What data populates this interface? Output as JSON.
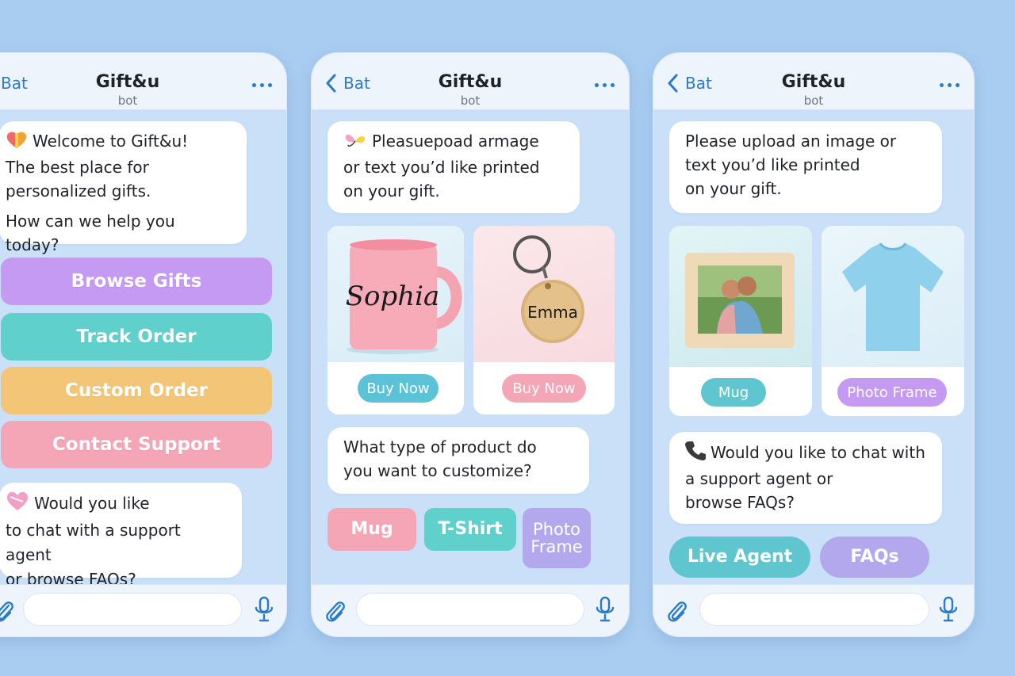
{
  "colors": {
    "background": "#a9cdf1",
    "accent": "#2b7bc9",
    "purple": "#c59af2",
    "teal": "#5fd0cc",
    "yellow": "#f2c676",
    "pink": "#f5a6b6",
    "lavender": "#b3a7ee"
  },
  "screens": [
    {
      "header": {
        "back_label": "Bat",
        "title": "Gift&u",
        "subtitle": "bot"
      },
      "welcome": {
        "icon": "gift-heart-icon",
        "line1": "Welcome to Gift&u!",
        "line2": "The best place for",
        "line3": "personalized gifts.",
        "line4": "How can we help you today?"
      },
      "menu": [
        "Browse Gifts",
        "Track Order",
        "Custom Order",
        "Contact Support"
      ],
      "support_prompt": {
        "icon": "heart-icon",
        "line1": "Would you like",
        "line2": "to chat with a support agent",
        "line3": "or browse FAQs?"
      }
    },
    {
      "header": {
        "back_label": "Bat",
        "title": "Gift&u",
        "subtitle": "bot"
      },
      "upload_prompt": {
        "icon": "butterfly-icon",
        "line1": "Pleasuepoad armage",
        "line2": "or text you’d like printed",
        "line3": "on your gift."
      },
      "products": [
        {
          "image": "mug-image",
          "engraving": "Sophia",
          "button": "Buy Now"
        },
        {
          "image": "keychain-image",
          "engraving": "Emma",
          "button": "Buy Now"
        }
      ],
      "type_question": {
        "line1": "What type of product do",
        "line2": "you want to customize?"
      },
      "options": [
        "Mug",
        "T-Shirt",
        "Photo Frame"
      ]
    },
    {
      "header": {
        "back_label": "Bat",
        "title": "Gift&u",
        "subtitle": "bot"
      },
      "upload_prompt": {
        "line1": "Please upload an image or",
        "line2": "text you’d like printed",
        "line3": "on your gift."
      },
      "products": [
        {
          "image": "photo-frame-image",
          "button": "Mug"
        },
        {
          "image": "tshirt-image",
          "button": "Photo Frame"
        }
      ],
      "support_prompt": {
        "icon": "phone-icon",
        "line1": "Would you like to chat with",
        "line2": "a support agent or",
        "line3": "browse FAQs?"
      },
      "options": [
        "Live Agent",
        "FAQs"
      ]
    }
  ]
}
